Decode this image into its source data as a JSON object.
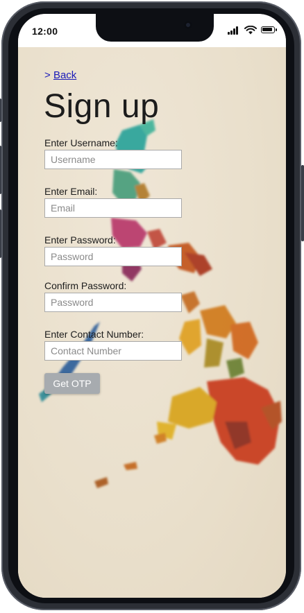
{
  "status_bar": {
    "time": "12:00",
    "icons": [
      "signal-icon",
      "wifi-icon",
      "battery-icon"
    ]
  },
  "page": {
    "back_prefix": ">",
    "back_label": "Back",
    "title": "Sign up"
  },
  "form": {
    "fields": [
      {
        "label": "Enter Username:",
        "placeholder": "Username",
        "value": ""
      },
      {
        "label": "Enter Email:",
        "placeholder": "Email",
        "value": ""
      },
      {
        "label": "Enter Password:",
        "placeholder": "Password",
        "value": ""
      },
      {
        "label": "Confirm Password:",
        "placeholder": "Password",
        "value": ""
      },
      {
        "label": "Enter Contact Number:",
        "placeholder": "Contact Number",
        "value": ""
      }
    ],
    "submit_label": "Get OTP"
  },
  "colors": {
    "link": "#1a1ab8",
    "button": "#a7abaf",
    "background": "#ede3d1",
    "frame": "#2c2f36"
  }
}
